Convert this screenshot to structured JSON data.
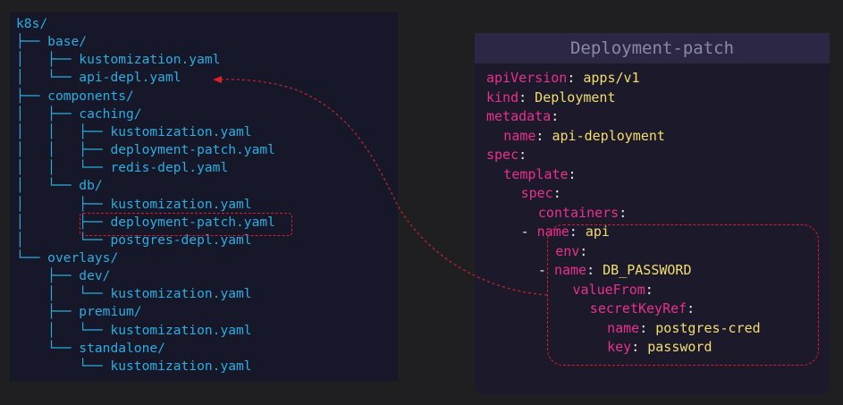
{
  "tree": {
    "lines": [
      {
        "prefix": "",
        "name": "k8s/"
      },
      {
        "prefix": "├── ",
        "name": "base/"
      },
      {
        "prefix": "│   ├── ",
        "name": "kustomization.yaml"
      },
      {
        "prefix": "│   └── ",
        "name": "api-depl.yaml"
      },
      {
        "prefix": "├── ",
        "name": "components/"
      },
      {
        "prefix": "│   ├── ",
        "name": "caching/"
      },
      {
        "prefix": "│   │   ├── ",
        "name": "kustomization.yaml"
      },
      {
        "prefix": "│   │   ├── ",
        "name": "deployment-patch.yaml"
      },
      {
        "prefix": "│   │   └── ",
        "name": "redis-depl.yaml"
      },
      {
        "prefix": "│   └── ",
        "name": "db/"
      },
      {
        "prefix": "│       ├── ",
        "name": "kustomization.yaml"
      },
      {
        "prefix": "│       ├── ",
        "name": "deployment-patch.yaml"
      },
      {
        "prefix": "│       └── ",
        "name": "postgres-depl.yaml"
      },
      {
        "prefix": "└── ",
        "name": "overlays/"
      },
      {
        "prefix": "    ├── ",
        "name": "dev/"
      },
      {
        "prefix": "    │   └── ",
        "name": "kustomization.yaml"
      },
      {
        "prefix": "    ├── ",
        "name": "premium/"
      },
      {
        "prefix": "    │   └── ",
        "name": "kustomization.yaml"
      },
      {
        "prefix": "    └── ",
        "name": "standalone/"
      },
      {
        "prefix": "        └── ",
        "name": "kustomization.yaml"
      }
    ]
  },
  "code_panel": {
    "title": "Deployment-patch",
    "lines": [
      {
        "indent": 0,
        "key": "apiVersion",
        "value": "apps/v1"
      },
      {
        "indent": 0,
        "key": "kind",
        "value": "Deployment"
      },
      {
        "indent": 0,
        "key": "metadata",
        "value": ""
      },
      {
        "indent": 1,
        "key": "name",
        "value": "api-deployment"
      },
      {
        "indent": 0,
        "key": "spec",
        "value": ""
      },
      {
        "indent": 1,
        "key": "template",
        "value": ""
      },
      {
        "indent": 2,
        "key": "spec",
        "value": ""
      },
      {
        "indent": 3,
        "key": "containers",
        "value": ""
      },
      {
        "indent": 3,
        "dash": true,
        "key": "name",
        "value": "api"
      },
      {
        "indent": 4,
        "key": "env",
        "value": ""
      },
      {
        "indent": 4,
        "dash": true,
        "key": "name",
        "value": "DB_PASSWORD"
      },
      {
        "indent": 5,
        "key": "valueFrom",
        "value": ""
      },
      {
        "indent": 6,
        "key": "secretKeyRef",
        "value": ""
      },
      {
        "indent": 7,
        "key": "name",
        "value": "postgres-cred"
      },
      {
        "indent": 7,
        "key": "key",
        "value": "password"
      }
    ]
  },
  "colors": {
    "tree_text": "#29aee0",
    "yaml_key": "#e8308e",
    "yaml_value": "#f2dd6e",
    "highlight": "#d81e2e"
  }
}
